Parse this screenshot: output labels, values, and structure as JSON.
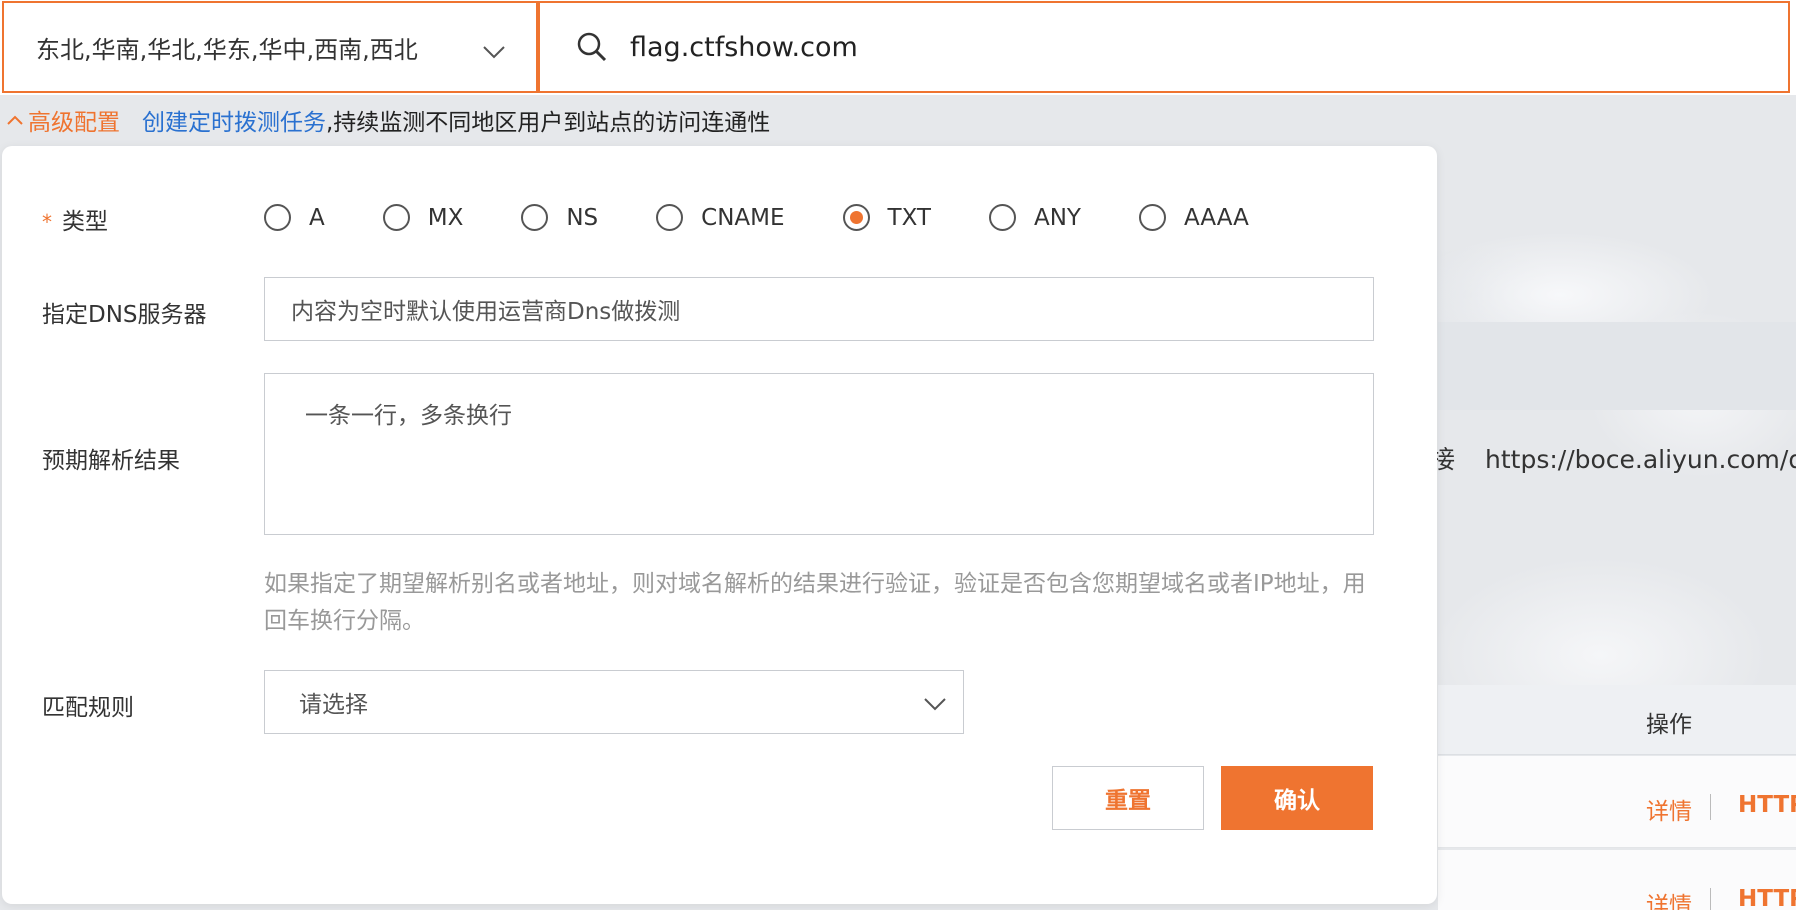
{
  "search": {
    "regions": "东北,华南,华北,华东,华中,西南,西北",
    "domain": "flag.ctfshow.com"
  },
  "advanced": {
    "toggle_label": "高级配置",
    "task_link": "创建定时拨测任务",
    "task_desc": ",持续监测不同地区用户到站点的访问连通性"
  },
  "form": {
    "required_mark": "*",
    "type_label": "类型",
    "types": [
      "A",
      "MX",
      "NS",
      "CNAME",
      "TXT",
      "ANY",
      "AAAA"
    ],
    "selected_type": "TXT",
    "dns_label": "指定DNS服务器",
    "dns_placeholder": "内容为空时默认使用运营商Dns做拨测",
    "expect_label": "预期解析结果",
    "expect_placeholder": "一条一行，多条换行",
    "hint": "如果指定了期望解析别名或者地址，则对域名解析的结果进行验证，验证是否包含您期望域名或者IP地址，用回车换行分隔。",
    "match_label": "匹配规则",
    "match_placeholder": "请选择",
    "reset_label": "重置",
    "confirm_label": "确认"
  },
  "background": {
    "link_prefix": "接",
    "link_url": "https://boce.aliyun.com/det",
    "col_action": "操作",
    "detail_label": "详情",
    "http_label": "HTTP"
  },
  "colors": {
    "accent": "#ef7430",
    "link": "#2a71d0"
  }
}
